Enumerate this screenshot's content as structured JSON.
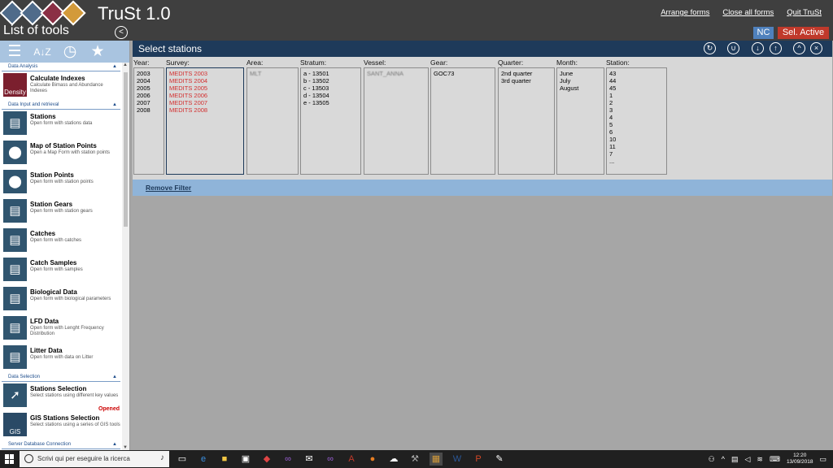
{
  "app": {
    "title": "TruSt 1.0"
  },
  "top_actions": {
    "arrange": "Arrange forms",
    "close_all": "Close all forms",
    "quit": "Quit TruSt"
  },
  "sidebar": {
    "title": "List of tools",
    "collapse_glyph": "<",
    "toolbar_icons": [
      "list-icon",
      "sort-az-icon",
      "clock-icon",
      "favorite-icon"
    ],
    "sections": [
      {
        "label": "Data Analysis",
        "tools": [
          {
            "name": "Calculate Indexes",
            "desc": "Calculate Bimass and Abundance Indexes",
            "icon": "density-icon",
            "icon_text": "Density"
          }
        ]
      },
      {
        "label": "Data Input and retrieval",
        "tools": [
          {
            "name": "Stations",
            "desc": "Open form with stations data",
            "icon": "database-icon"
          },
          {
            "name": "Map of Station Points",
            "desc": "Open a Map Form with station points",
            "icon": "map-pin-icon"
          },
          {
            "name": "Station Points",
            "desc": "Open form with station points",
            "icon": "map-pin-icon"
          },
          {
            "name": "Station Gears",
            "desc": "Open form with station gears",
            "icon": "database-icon"
          },
          {
            "name": "Catches",
            "desc": "Open form with catches",
            "icon": "database-icon"
          },
          {
            "name": "Catch Samples",
            "desc": "Open form with samples",
            "icon": "database-icon"
          },
          {
            "name": "Biological Data",
            "desc": "Open form with biological parameters",
            "icon": "database-icon"
          },
          {
            "name": "LFD Data",
            "desc": "Open form with Lenght Frequency Distribution",
            "icon": "database-icon"
          },
          {
            "name": "Litter Data",
            "desc": "Open form with data on Litter",
            "icon": "database-icon"
          }
        ]
      },
      {
        "label": "Data Selection",
        "tools": [
          {
            "name": "Stations Selection",
            "desc": "Select stations using different key values",
            "icon": "cursor-icon",
            "status": "Opened"
          },
          {
            "name": "GIS Stations Selection",
            "desc": "Select stations using a series of GIS tools",
            "icon": "gis-icon",
            "icon_text": "GIS"
          }
        ]
      },
      {
        "label": "Server Database Connection",
        "tools": []
      }
    ]
  },
  "badges": {
    "nc": "NC",
    "sel_active": "Sel. Active"
  },
  "panel": {
    "title": "Select stations",
    "columns": [
      {
        "label": "Year:",
        "items": [
          "2003",
          "2004",
          "2005",
          "2006",
          "2007",
          "2008"
        ]
      },
      {
        "label": "Survey:",
        "items": [
          "MEDITS 2003",
          "MEDITS 2004",
          "MEDITS 2005",
          "MEDITS 2006",
          "MEDITS 2007",
          "MEDITS 2008"
        ]
      },
      {
        "label": "Area:",
        "items": [
          "MLT"
        ]
      },
      {
        "label": "Stratum:",
        "items": [
          "a - 13501",
          "b - 13502",
          "c - 13503",
          "d - 13504",
          "e - 13505"
        ]
      },
      {
        "label": "Vessel:",
        "items": [
          "SANT_ANNA"
        ]
      },
      {
        "label": "Gear:",
        "items": [
          "GOC73"
        ]
      },
      {
        "label": "Quarter:",
        "items": [
          "2nd quarter",
          "3rd quarter"
        ]
      },
      {
        "label": "Month:",
        "items": [
          "June",
          "July",
          "August"
        ]
      },
      {
        "label": "Station:",
        "items": [
          "43",
          "44",
          "45",
          "1",
          "2",
          "3",
          "4",
          "5",
          "6",
          "10",
          "11",
          "7",
          "..."
        ]
      }
    ],
    "remove_filter": "Remove Filter"
  },
  "taskbar": {
    "search_placeholder": "Scrivi qui per eseguire la ricerca",
    "time": "12:20",
    "date": "13/09/2018"
  },
  "colors": {
    "title_bar": "#3f3f3f",
    "panel_header": "#1e3a5a",
    "filter_bar": "#8fb4d9",
    "survey_text": "#d32f2f",
    "badge_nc": "#4f81bd",
    "badge_sel": "#c0392b"
  }
}
